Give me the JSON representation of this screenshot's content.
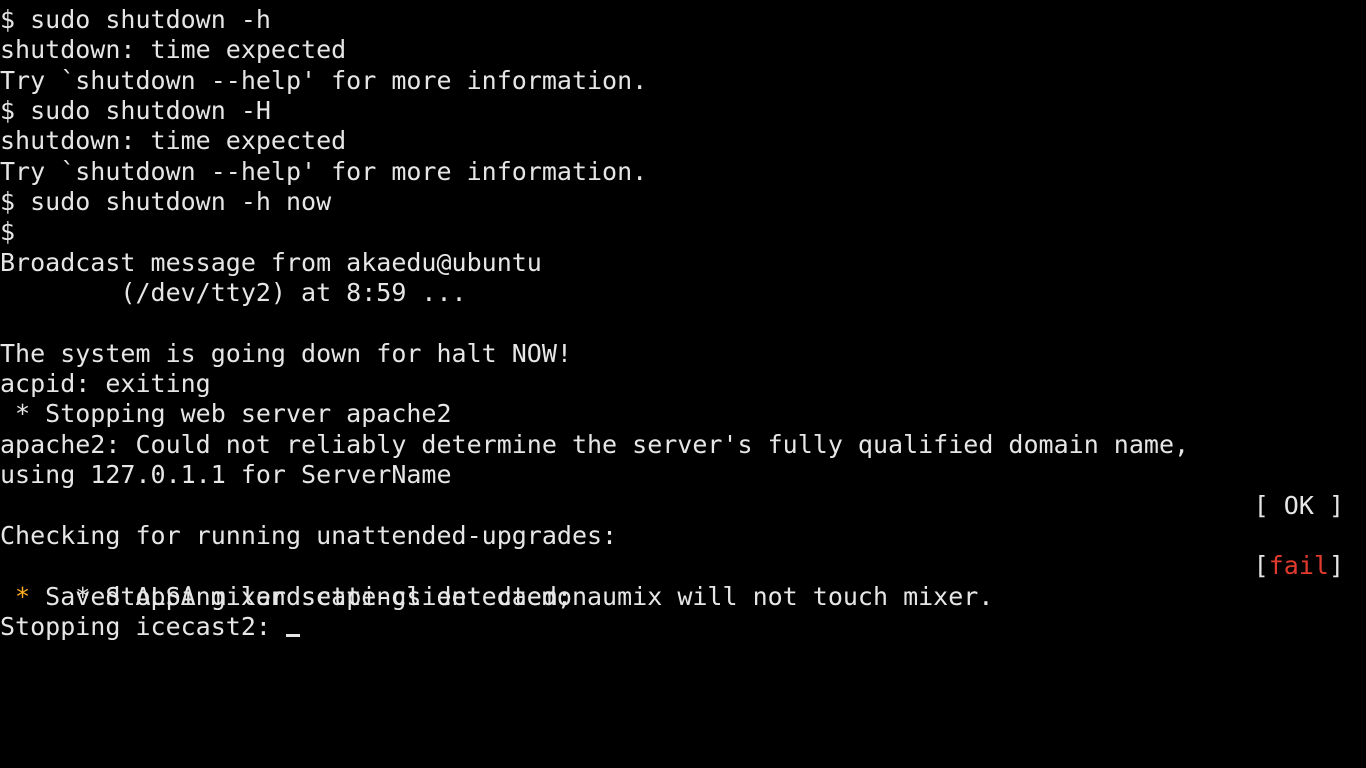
{
  "terminal": {
    "lines": [
      "$ sudo shutdown -h",
      "shutdown: time expected",
      "Try `shutdown --help' for more information.",
      "$ sudo shutdown -H",
      "shutdown: time expected",
      "Try `shutdown --help' for more information.",
      "$ sudo shutdown -h now",
      "$",
      "Broadcast message from akaedu@ubuntu",
      "        (/dev/tty2) at 8:59 ...",
      "",
      "The system is going down for halt NOW!",
      "acpid: exiting",
      " * Stopping web server apache2",
      "apache2: Could not reliably determine the server's fully qualified domain name,",
      "using 127.0.1.1 for ServerName"
    ],
    "ok_status": "[ OK ]",
    "checking_line": "Checking for running unattended-upgrades:",
    "landscape_line": " * Stopping landscape-client daemon",
    "fail_open": "[",
    "fail_word": "fail",
    "fail_close": "]",
    "alsa_star": " *",
    "alsa_text": " Saved ALSA mixer settings detected; aumix will not touch mixer.",
    "prompt_line": "Stopping icecast2: "
  },
  "colors": {
    "background": "#000000",
    "text": "#e6e6e6",
    "fail": "#e23b2e",
    "warning": "#ffb020"
  }
}
